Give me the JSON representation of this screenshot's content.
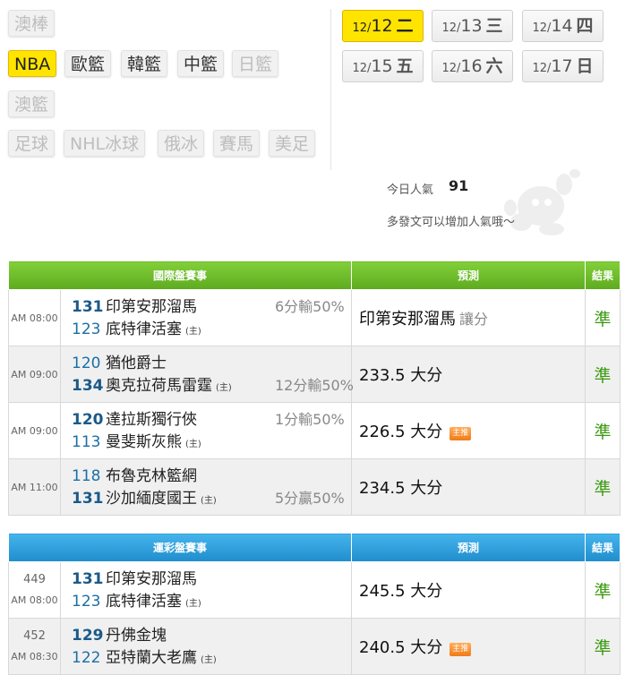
{
  "sports": {
    "top_partial": {
      "label": "澳棒"
    },
    "row2": [
      {
        "label": "NBA"
      },
      {
        "label": "歐籃"
      },
      {
        "label": "韓籃"
      },
      {
        "label": "中籃"
      },
      {
        "label": "日籃"
      }
    ],
    "row3": [
      {
        "label": "澳籃"
      }
    ],
    "row4": [
      {
        "label": "足球"
      },
      {
        "label": "NHL冰球"
      },
      {
        "label": "俄冰"
      },
      {
        "label": "賽馬"
      },
      {
        "label": "美足"
      }
    ]
  },
  "dates": [
    {
      "num": "12/",
      "day": "12",
      "week": "二"
    },
    {
      "num": "12/",
      "day": "13",
      "week": "三"
    },
    {
      "num": "12/",
      "day": "14",
      "week": "四"
    },
    {
      "num": "12/",
      "day": "15",
      "week": "五"
    },
    {
      "num": "12/",
      "day": "16",
      "week": "六"
    },
    {
      "num": "12/",
      "day": "17",
      "week": "日"
    }
  ],
  "popularity": {
    "label": "今日人氣",
    "value": "91",
    "hint": "多發文可以增加人氣哦～"
  },
  "international": {
    "header": {
      "title": "國際盤賽事",
      "prediction": "預測",
      "result": "結果"
    },
    "rows": [
      {
        "time": "AM 08:00",
        "away": {
          "num": "131",
          "name": "印第安那溜馬"
        },
        "home": {
          "num": "123",
          "name": "底特律活塞",
          "host": "(主)"
        },
        "spread": "6分輸50%",
        "prediction": "印第安那溜馬",
        "prediction_sub": "讓分",
        "result": "準"
      },
      {
        "time": "AM 09:00",
        "away": {
          "num": "120",
          "name": "猶他爵士"
        },
        "home": {
          "num": "134",
          "name": "奧克拉荷馬雷霆",
          "host": "(主)"
        },
        "spread": "12分輸50%",
        "prediction": "233.5 大分",
        "result": "準"
      },
      {
        "time": "AM 09:00",
        "away": {
          "num": "120",
          "name": "達拉斯獨行俠"
        },
        "home": {
          "num": "113",
          "name": "曼斐斯灰熊",
          "host": "(主)"
        },
        "spread": "1分輸50%",
        "prediction": "226.5 大分",
        "badge": "主推",
        "result": "準"
      },
      {
        "time": "AM 11:00",
        "away": {
          "num": "118",
          "name": "布魯克林籃網"
        },
        "home": {
          "num": "131",
          "name": "沙加緬度國王",
          "host": "(主)"
        },
        "spread": "5分贏50%",
        "prediction": "234.5 大分",
        "result": "準"
      }
    ]
  },
  "lottery": {
    "header": {
      "title": "運彩盤賽事",
      "prediction": "預測",
      "result": "結果"
    },
    "rows": [
      {
        "code": "449",
        "time": "AM 08:00",
        "away": {
          "num": "131",
          "name": "印第安那溜馬"
        },
        "home": {
          "num": "123",
          "name": "底特律活塞",
          "host": "(主)"
        },
        "prediction": "245.5 大分",
        "result": "準"
      },
      {
        "code": "452",
        "time": "AM 08:30",
        "away": {
          "num": "129",
          "name": "丹佛金塊"
        },
        "home": {
          "num": "122",
          "name": "亞特蘭大老鷹",
          "host": "(主)"
        },
        "prediction": "240.5 大分",
        "badge": "主推",
        "result": "準"
      }
    ]
  },
  "colors": {
    "active_tab": "#ffe400",
    "green_header": "#6cbc2a",
    "blue_header": "#2a9fdd",
    "result_green": "#3b9a0f",
    "team_number": "#1b6fa5",
    "badge": "#f08a25"
  },
  "icons": {
    "mascot": "cartoon-mascot-watermark"
  }
}
